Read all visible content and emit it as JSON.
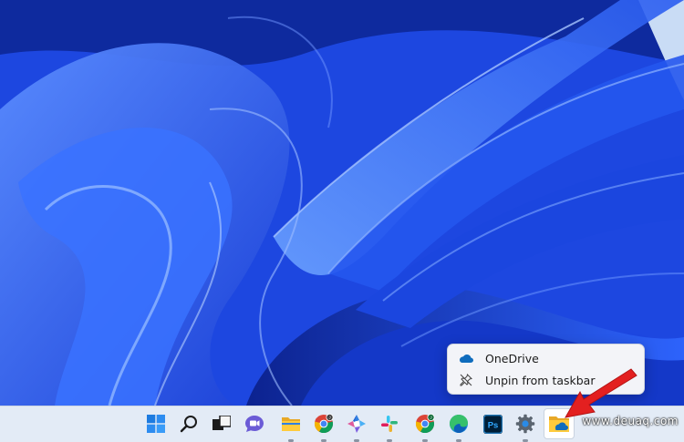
{
  "desktop": {
    "wallpaper": "blue-abstract-ribbons"
  },
  "context_menu": {
    "items": [
      {
        "label": "OneDrive",
        "icon": "onedrive-cloud-icon"
      },
      {
        "label": "Unpin from taskbar",
        "icon": "unpin-icon"
      }
    ]
  },
  "taskbar": {
    "apps": [
      {
        "name": "start",
        "icon": "windows-start-icon"
      },
      {
        "name": "search",
        "icon": "search-icon"
      },
      {
        "name": "task-view",
        "icon": "task-view-icon"
      },
      {
        "name": "chat",
        "icon": "teams-chat-icon"
      },
      {
        "name": "file-explorer",
        "icon": "folder-icon"
      },
      {
        "name": "chrome-profile-j",
        "icon": "chrome-icon",
        "badge": "J"
      },
      {
        "name": "copilot-app",
        "icon": "colorful-app-icon"
      },
      {
        "name": "slack",
        "icon": "slack-icon"
      },
      {
        "name": "chrome-profile-j-2",
        "icon": "chrome-icon",
        "badge": "J"
      },
      {
        "name": "edge",
        "icon": "edge-icon"
      },
      {
        "name": "photoshop",
        "icon": "photoshop-icon",
        "text": "Ps"
      },
      {
        "name": "settings",
        "icon": "gear-icon"
      },
      {
        "name": "onedrive",
        "icon": "onedrive-folder-icon"
      }
    ]
  },
  "watermark": "www.deuaq.com",
  "colors": {
    "accent": "#0067c0",
    "arrow": "#e32020",
    "taskbar_bg": "#e3ebf6"
  }
}
